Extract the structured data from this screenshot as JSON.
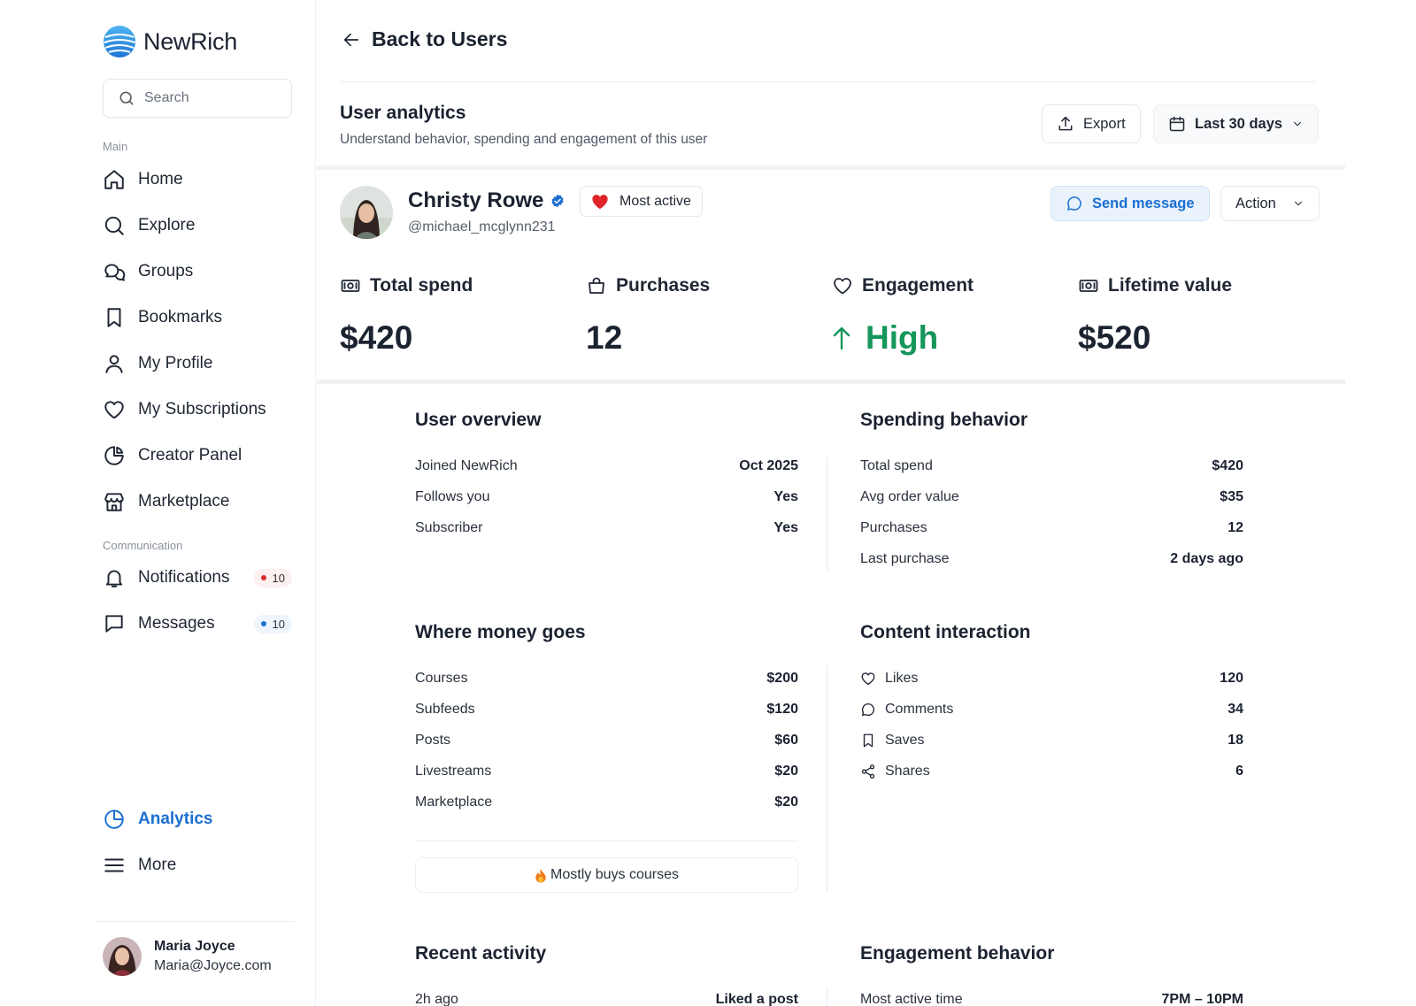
{
  "app": {
    "brand": "NewRich"
  },
  "search": {
    "placeholder": "Search"
  },
  "sidebar": {
    "main_label": "Main",
    "comm_label": "Communication",
    "items": [
      {
        "label": "Home",
        "icon": "home-icon"
      },
      {
        "label": "Explore",
        "icon": "search-icon"
      },
      {
        "label": "Groups",
        "icon": "chat-bubbles-icon"
      },
      {
        "label": "Bookmarks",
        "icon": "bookmark-icon"
      },
      {
        "label": "My Profile",
        "icon": "user-icon"
      },
      {
        "label": "My Subscriptions",
        "icon": "heart-icon"
      },
      {
        "label": "Creator Panel",
        "icon": "pie-chart-icon"
      },
      {
        "label": "Marketplace",
        "icon": "store-icon"
      }
    ],
    "notifications": {
      "label": "Notifications",
      "count": "10",
      "icon": "bell-icon",
      "dot_color": "#d92c2c"
    },
    "messages": {
      "label": "Messages",
      "count": "10",
      "icon": "message-icon",
      "dot_color": "#1b6fd1"
    },
    "analytics": {
      "label": "Analytics",
      "icon": "pie-chart-icon",
      "active": true
    },
    "more": {
      "label": "More",
      "icon": "menu-icon"
    }
  },
  "account": {
    "name": "Maria Joyce",
    "email": "Maria@Joyce.com"
  },
  "header": {
    "back_label": "Back to Users",
    "title": "User analytics",
    "subtitle": "Understand behavior, spending and engagement of this user",
    "export_label": "Export",
    "range_label": "Last 30 days"
  },
  "user": {
    "name": "Christy Rowe",
    "handle": "@michael_mcglynn231",
    "verified": true,
    "tag": "Most active",
    "send_label": "Send message",
    "action_label": "Action"
  },
  "metrics": [
    {
      "label": "Total spend",
      "value": "$420",
      "icon": "cash-icon"
    },
    {
      "label": "Purchases",
      "value": "12",
      "icon": "shopping-bag-icon"
    },
    {
      "label": "Engagement",
      "value": "High",
      "icon": "heart-icon",
      "trend": "up",
      "color": "#15965a"
    },
    {
      "label": "Lifetime value",
      "value": "$520",
      "icon": "cash-icon"
    }
  ],
  "overview": {
    "title": "User overview",
    "rows": [
      {
        "k": "Joined NewRich",
        "v": "Oct 2025"
      },
      {
        "k": "Follows you",
        "v": "Yes"
      },
      {
        "k": "Subscriber",
        "v": "Yes"
      }
    ]
  },
  "spending": {
    "title": "Spending behavior",
    "rows": [
      {
        "k": "Total spend",
        "v": "$420"
      },
      {
        "k": "Avg order value",
        "v": "$35"
      },
      {
        "k": "Purchases",
        "v": "12"
      },
      {
        "k": "Last purchase",
        "v": "2 days ago"
      }
    ]
  },
  "money": {
    "title": "Where money goes",
    "rows": [
      {
        "k": "Courses",
        "v": "$200"
      },
      {
        "k": "Subfeeds",
        "v": "$120"
      },
      {
        "k": "Posts",
        "v": "$60"
      },
      {
        "k": "Livestreams",
        "v": "$20"
      },
      {
        "k": "Marketplace",
        "v": "$20"
      }
    ],
    "insight": "Mostly buys courses"
  },
  "content": {
    "title": "Content interaction",
    "rows": [
      {
        "k": "Likes",
        "v": "120",
        "icon": "heart-icon"
      },
      {
        "k": "Comments",
        "v": "34",
        "icon": "comment-icon"
      },
      {
        "k": "Saves",
        "v": "18",
        "icon": "bookmark-icon"
      },
      {
        "k": "Shares",
        "v": "6",
        "icon": "share-icon"
      }
    ]
  },
  "recent": {
    "title": "Recent activity",
    "rows": [
      {
        "k": "2h ago",
        "v": "Liked a post"
      }
    ]
  },
  "engagement": {
    "title": "Engagement behavior",
    "rows": [
      {
        "k": "Most active time",
        "v": "7PM – 10PM"
      }
    ]
  },
  "colors": {
    "accent": "#1b6fd1",
    "positive": "#15965a",
    "tag_heart": "#e0242b"
  }
}
